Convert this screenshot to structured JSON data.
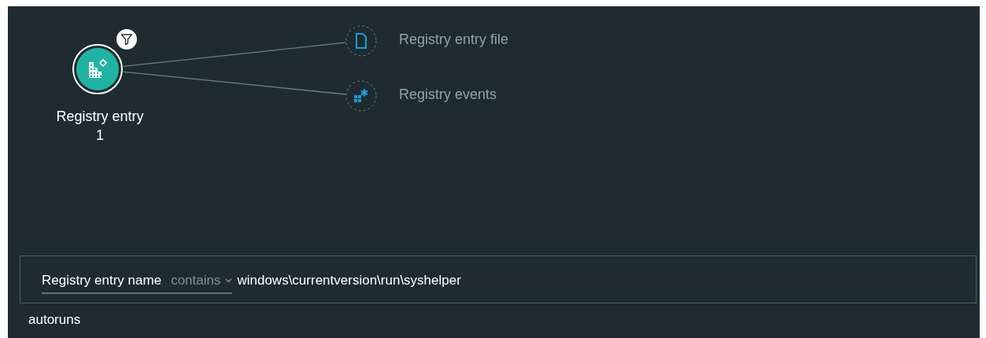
{
  "graph": {
    "root": {
      "label": "Registry entry",
      "count": "1",
      "filtered": true
    },
    "children": [
      {
        "label": "Registry entry file",
        "kind": "file"
      },
      {
        "label": "Registry events",
        "kind": "events"
      }
    ]
  },
  "filter": {
    "field": "Registry entry name",
    "operator": "contains",
    "value": "windows\\currentversion\\run\\syshelper"
  },
  "note": "autoruns"
}
